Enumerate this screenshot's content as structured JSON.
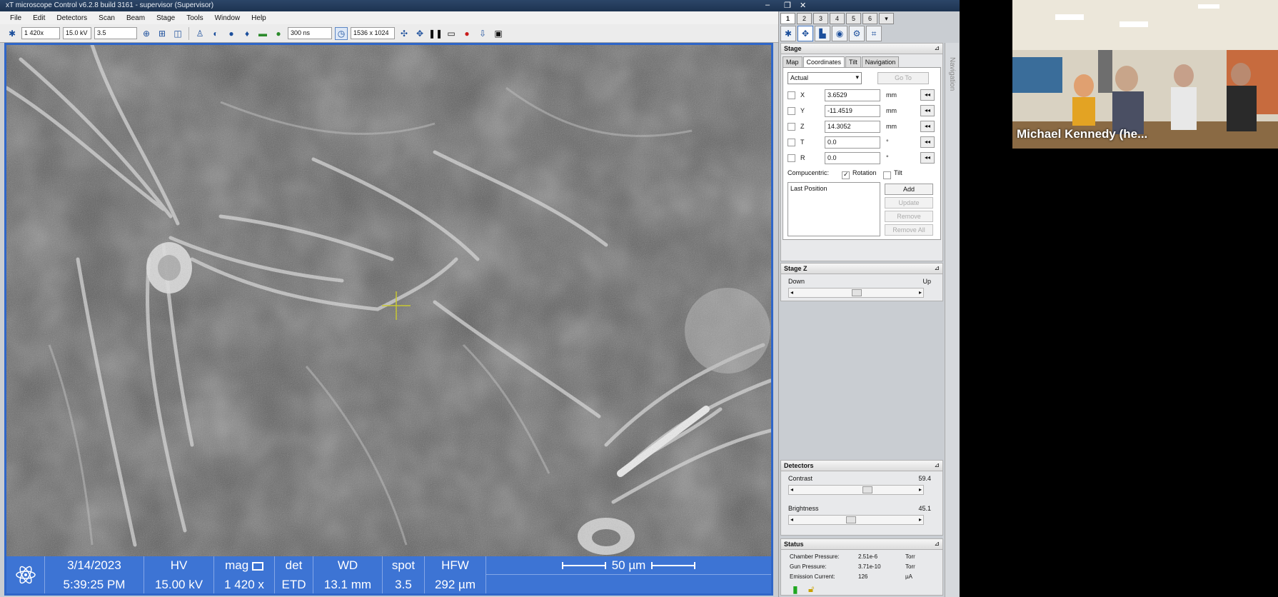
{
  "window": {
    "title": "xT microscope Control v6.2.8 build 3161 - supervisor (Supervisor)"
  },
  "menu": [
    "File",
    "Edit",
    "Detectors",
    "Scan",
    "Beam",
    "Stage",
    "Tools",
    "Window",
    "Help"
  ],
  "toolbar": {
    "magnification": "1 420x",
    "hv": "15.0 kV",
    "spot": "3.5",
    "dwell": "300 ns",
    "resolution": "1536 x 1024"
  },
  "databar": {
    "date": "3/14/2023",
    "time": "5:39:25 PM",
    "hv_label": "HV",
    "hv_value": "15.00 kV",
    "mag_label": "mag",
    "mag_value": "1 420 x",
    "det_label": "det",
    "det_value": "ETD",
    "wd_label": "WD",
    "wd_value": "13.1 mm",
    "spot_label": "spot",
    "spot_value": "3.5",
    "hfw_label": "HFW",
    "hfw_value": "292 µm",
    "scale_label": "50 µm"
  },
  "panel_tabs": [
    "1",
    "2",
    "3",
    "4",
    "5",
    "6"
  ],
  "navigation_label": "Navigation",
  "stage": {
    "title": "Stage",
    "tabs": [
      "Map",
      "Coordinates",
      "Tilt",
      "Navigation"
    ],
    "mode": "Actual",
    "goto_label": "Go To",
    "coords": [
      {
        "label": "X",
        "value": "3.6529",
        "unit": "mm"
      },
      {
        "label": "Y",
        "value": "-11.4519",
        "unit": "mm"
      },
      {
        "label": "Z",
        "value": "14.3052",
        "unit": "mm"
      },
      {
        "label": "T",
        "value": "0.0",
        "unit": "°"
      },
      {
        "label": "R",
        "value": "0.0",
        "unit": "°"
      }
    ],
    "compucentric_label": "Compucentric:",
    "rotation_label": "Rotation",
    "tilt_label": "Tilt",
    "list_item": "Last Position",
    "buttons": [
      "Add",
      "Update",
      "Remove",
      "Remove All"
    ]
  },
  "stage_z": {
    "title": "Stage Z",
    "down": "Down",
    "up": "Up"
  },
  "detectors": {
    "title": "Detectors",
    "contrast_label": "Contrast",
    "contrast_value": "59.4",
    "brightness_label": "Brightness",
    "brightness_value": "45.1"
  },
  "status": {
    "title": "Status",
    "rows": [
      {
        "label": "Chamber Pressure:",
        "value": "2.51e-6",
        "unit": "Torr"
      },
      {
        "label": "Gun Pressure:",
        "value": "3.71e-10",
        "unit": "Torr"
      },
      {
        "label": "Emission Current:",
        "value": "126",
        "unit": "µA"
      }
    ]
  },
  "webcam": {
    "participant": "Michael Kennedy (he..."
  }
}
